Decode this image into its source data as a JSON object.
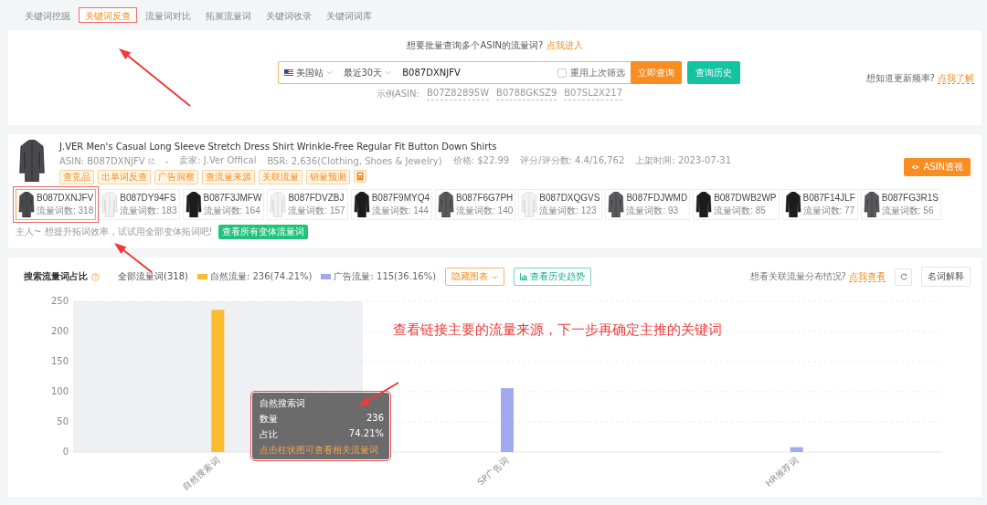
{
  "tabs": [
    {
      "label": "关键词挖掘",
      "selected": false
    },
    {
      "label": "关键词反查",
      "selected": true
    },
    {
      "label": "流量词对比",
      "selected": false
    },
    {
      "label": "拓展流量词",
      "selected": false
    },
    {
      "label": "关键词收录",
      "selected": false
    },
    {
      "label": "关键词词库",
      "selected": false
    }
  ],
  "search": {
    "batch_prompt": "想要批量查询多个ASIN的流量词?",
    "batch_link": "点我进入",
    "marketplace": "美国站",
    "period": "最近30天",
    "value": "B087DXNJFV",
    "reuse_filter": {
      "label": "重用上次筛选",
      "checked": false
    },
    "query_button": "立即查询",
    "history_button": "查询历史",
    "examples_label": "示例ASIN:",
    "examples": [
      "B07Z82895W",
      "B0788GKSZ9",
      "B07SL2X217"
    ],
    "frequency_prompt": "想知道更新频率?",
    "frequency_link": "点我了解"
  },
  "product": {
    "title": "J.VER Men's Casual Long Sleeve Stretch Dress Shirt Wrinkle-Free Regular Fit Button Down Shirts",
    "meta": [
      "ASIN: B087DXNJFV",
      "-",
      "卖家: J.Ver Offical",
      "BSR: 2,636(Clothing, Shoes & Jewelry)",
      "价格: $22.99",
      "评分/评分数: 4.4/16,762",
      "上架时间: 2023-07-31"
    ],
    "tags": [
      "查竞品",
      "出单词反查",
      "广告洞察",
      "查流量来源",
      "关联流量",
      "销量预测"
    ],
    "insight_button": "ASIN透视",
    "variants": [
      {
        "asin": "B087DXNJFV",
        "count": "流量词数: 318",
        "color": "#4a4a4e",
        "selected": true
      },
      {
        "asin": "B087DY94FS",
        "count": "流量词数: 183",
        "color": "#f2f2f2",
        "selected": false
      },
      {
        "asin": "B087F3JMFW",
        "count": "流量词数: 164",
        "color": "#1c1c1e",
        "selected": false
      },
      {
        "asin": "B087FDVZBJ",
        "count": "流量词数: 157",
        "color": "#f2f2f2",
        "selected": false
      },
      {
        "asin": "B087F9MYQ4",
        "count": "流量词数: 144",
        "color": "#1c1c1e",
        "selected": false
      },
      {
        "asin": "B087F6G7PH",
        "count": "流量词数: 140",
        "color": "#5a5a5e",
        "selected": false
      },
      {
        "asin": "B087DXQGVS",
        "count": "流量词数: 123",
        "color": "#f2f2f2",
        "selected": false
      },
      {
        "asin": "B087FDJWMD",
        "count": "流量词数: 93",
        "color": "#5a5a5e",
        "selected": false
      },
      {
        "asin": "B087DWB2WP",
        "count": "流量词数: 85",
        "color": "#1c1c1e",
        "selected": false
      },
      {
        "asin": "B087F14JLF",
        "count": "流量词数: 77",
        "color": "#1c1c1e",
        "selected": false
      },
      {
        "asin": "B087FG3R1S",
        "count": "流量词数: 56",
        "color": "#5a5a5e",
        "selected": false
      }
    ],
    "tip": "主人~ 想提升拓词效率，试试用全部变体拓词吧!",
    "all_variants_button": "查看所有变体流量词"
  },
  "traffic": {
    "title": "搜索流量词占比",
    "total": "全部流量词(318)",
    "hide_button": "隐藏图表",
    "trend_button": "查看历史趋势",
    "related_prompt": "想看关联流量分布情况?",
    "related_link": "点我查看",
    "glossary_button": "名词解释",
    "chart_data": {
      "type": "bar",
      "categories": [
        "自然搜索词",
        "SP广告词",
        "HR推荐词"
      ],
      "series": [
        {
          "name": "自然流量: 236(74.21%)",
          "color": "#fbbd2f",
          "values": [
            236,
            null,
            null
          ]
        },
        {
          "name": "广告流量: 115(36.16%)",
          "color": "#a1a9f0",
          "values": [
            null,
            106,
            8
          ]
        }
      ],
      "ylim": [
        0,
        250
      ],
      "yticks": [
        0,
        50,
        100,
        150,
        200,
        250
      ],
      "stacked": true,
      "grid": true
    },
    "tooltip": {
      "title": "自然搜索词",
      "rows": [
        {
          "label": "数量",
          "value": "236"
        },
        {
          "label": "占比",
          "value": "74.21%"
        }
      ],
      "hint": "点击柱状图可查看相关流量词"
    }
  },
  "annotations": [
    {
      "text": "查看链接主要的流量来源，下一步再确定主推的关键词"
    }
  ]
}
